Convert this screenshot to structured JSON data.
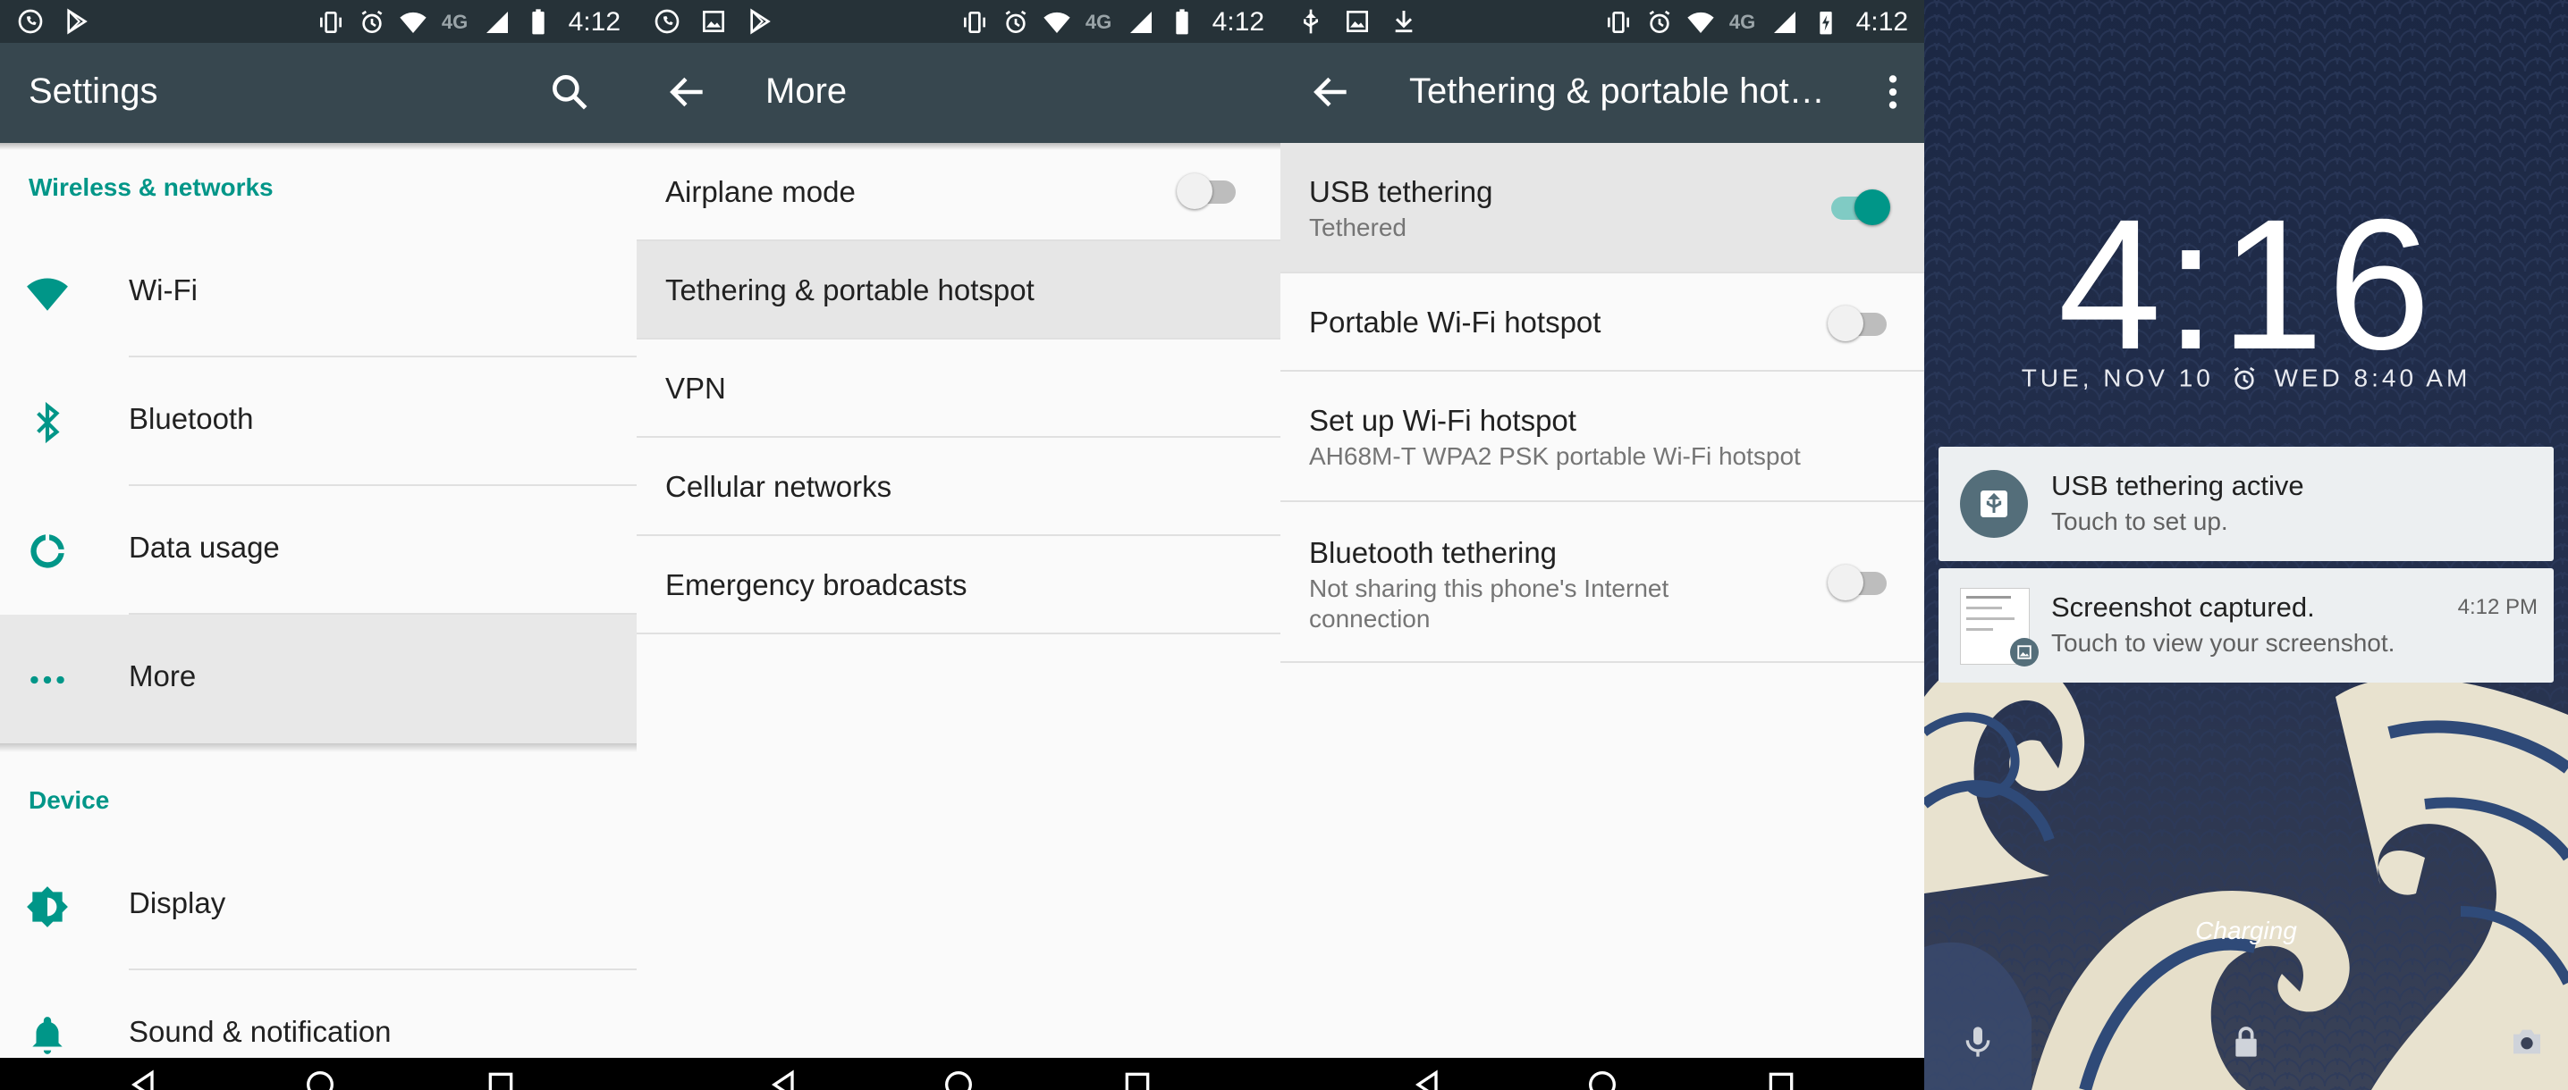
{
  "colors": {
    "accent": "#009688",
    "toolbar": "#37474f",
    "statusbar": "#263238"
  },
  "statusbar": {
    "time": "4:12",
    "network": "4G"
  },
  "settings": {
    "title": "Settings",
    "sections": [
      "Wireless & networks",
      "Device"
    ],
    "items": [
      {
        "label": "Wi-Fi",
        "icon": "wifi-icon"
      },
      {
        "label": "Bluetooth",
        "icon": "bluetooth-icon"
      },
      {
        "label": "Data usage",
        "icon": "data-usage-icon"
      },
      {
        "label": "More",
        "icon": "more-icon",
        "selected": true
      },
      {
        "label": "Display",
        "icon": "display-icon"
      },
      {
        "label": "Sound & notification",
        "icon": "bell-icon"
      }
    ]
  },
  "more": {
    "title": "More",
    "items": [
      {
        "label": "Airplane mode",
        "switch": false
      },
      {
        "label": "Tethering & portable hotspot",
        "selected": true
      },
      {
        "label": "VPN"
      },
      {
        "label": "Cellular networks"
      },
      {
        "label": "Emergency broadcasts"
      }
    ]
  },
  "tethering": {
    "title": "Tethering & portable hot…",
    "items": [
      {
        "label": "USB tethering",
        "summary": "Tethered",
        "switch": true
      },
      {
        "label": "Portable Wi-Fi hotspot",
        "switch": false
      },
      {
        "label": "Set up Wi-Fi hotspot",
        "summary": "AH68M-T WPA2 PSK portable Wi-Fi hotspot"
      },
      {
        "label": "Bluetooth tethering",
        "summary_line1": "Not sharing this phone's Internet",
        "summary_line2": "connection",
        "switch": false
      }
    ]
  },
  "lockscreen": {
    "time": "4:16",
    "date": "TUE, NOV 10",
    "alarm": "WED 8:40 AM",
    "notifications": [
      {
        "title": "USB tethering active",
        "text": "Touch to set up.",
        "icon": "usb-icon"
      },
      {
        "title": "Screenshot captured.",
        "text": "Touch to view your screenshot.",
        "time": "4:12 PM",
        "icon": "image-icon"
      }
    ],
    "charging": "Charging"
  }
}
